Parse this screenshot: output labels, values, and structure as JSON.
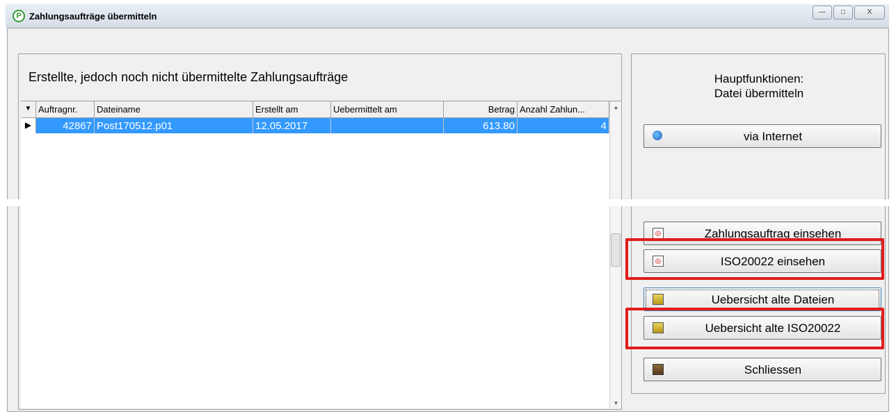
{
  "window": {
    "title": "Zahlungsaufträge übermitteln",
    "app_icon": "P",
    "controls": {
      "minimize": "—",
      "maximize": "□",
      "close": "X"
    }
  },
  "left_panel": {
    "heading": "Erstellte, jedoch noch nicht übermittelte Zahlungsaufträge",
    "columns": [
      "Auftragnr.",
      "Dateiname",
      "Erstellt am",
      "Uebermittelt am",
      "Betrag",
      "Anzahl Zahlun..."
    ],
    "rows": [
      {
        "auftragnr": "42867",
        "dateiname": "Post170512.p01",
        "erstellt_am": "12.05.2017",
        "uebermittelt_am": "",
        "betrag": "613.80",
        "anzahl": "4"
      }
    ],
    "row_indicator": "▶",
    "header_indicator": "▼"
  },
  "right_panel": {
    "title_line1": "Hauptfunktionen:",
    "title_line2": "Datei übermitteln",
    "buttons": {
      "via_internet": "via Internet",
      "zahlungsauftrag_einsehen": "Zahlungsauftrag einsehen",
      "iso_einsehen": "ISO20022 einsehen",
      "uebersicht_alte_dateien": "Uebersicht alte Dateien",
      "uebersicht_alte_iso": "Uebersicht alte ISO20022",
      "schliessen": "Schliessen"
    }
  },
  "icons": {
    "globe": "globe-icon",
    "doc": "document-magnifier-icon",
    "box": "archive-box-icon",
    "door": "exit-door-icon"
  },
  "colors": {
    "selection": "#3399ff",
    "highlight": "#e21b1b"
  }
}
